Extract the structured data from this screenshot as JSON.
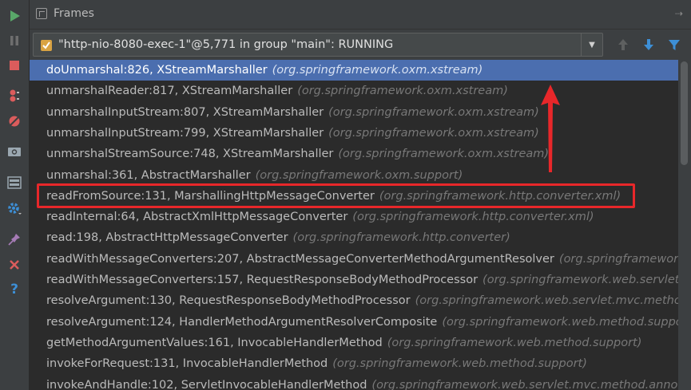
{
  "header": {
    "title": "Frames"
  },
  "thread": {
    "label": "\"http-nio-8080-exec-1\"@5,771 in group \"main\": RUNNING"
  },
  "frames": [
    {
      "method": "doUnmarshal:826, XStreamMarshaller",
      "pkg": "(org.springframework.oxm.xstream)"
    },
    {
      "method": "unmarshalReader:817, XStreamMarshaller",
      "pkg": "(org.springframework.oxm.xstream)"
    },
    {
      "method": "unmarshalInputStream:807, XStreamMarshaller",
      "pkg": "(org.springframework.oxm.xstream)"
    },
    {
      "method": "unmarshalInputStream:799, XStreamMarshaller",
      "pkg": "(org.springframework.oxm.xstream)"
    },
    {
      "method": "unmarshalStreamSource:748, XStreamMarshaller",
      "pkg": "(org.springframework.oxm.xstream)"
    },
    {
      "method": "unmarshal:361, AbstractMarshaller",
      "pkg": "(org.springframework.oxm.support)"
    },
    {
      "method": "readFromSource:131, MarshallingHttpMessageConverter",
      "pkg": "(org.springframework.http.converter.xml)"
    },
    {
      "method": "readInternal:64, AbstractXmlHttpMessageConverter",
      "pkg": "(org.springframework.http.converter.xml)"
    },
    {
      "method": "read:198, AbstractHttpMessageConverter",
      "pkg": "(org.springframework.http.converter)"
    },
    {
      "method": "readWithMessageConverters:207, AbstractMessageConverterMethodArgumentResolver",
      "pkg": "(org.springframework"
    },
    {
      "method": "readWithMessageConverters:157, RequestResponseBodyMethodProcessor",
      "pkg": "(org.springframework.web.servlet."
    },
    {
      "method": "resolveArgument:130, RequestResponseBodyMethodProcessor",
      "pkg": "(org.springframework.web.servlet.mvc.method"
    },
    {
      "method": "resolveArgument:124, HandlerMethodArgumentResolverComposite",
      "pkg": "(org.springframework.web.method.suppo"
    },
    {
      "method": "getMethodArgumentValues:161, InvocableHandlerMethod",
      "pkg": "(org.springframework.web.method.support)"
    },
    {
      "method": "invokeForRequest:131, InvocableHandlerMethod",
      "pkg": "(org.springframework.web.method.support)"
    },
    {
      "method": "invokeAndHandle:102, ServletInvocableHandlerMethod",
      "pkg": "(org.springframework.web.servlet.mvc.method.annotat"
    }
  ],
  "colors": {
    "selection": "#4b6eaf",
    "annotation": "#e8272a",
    "resume": "#59a869",
    "stop": "#db5c5c"
  },
  "icons": {
    "toolbar": [
      "resume-icon",
      "pause-icon",
      "stop-icon",
      "view-breakpoints-icon",
      "mute-breakpoints-icon",
      "camera-icon",
      "layout-icon",
      "settings-icon",
      "pin-icon",
      "close-icon",
      "help-icon"
    ],
    "nav": [
      "arrow-up-icon",
      "arrow-down-icon",
      "filter-icon"
    ]
  }
}
